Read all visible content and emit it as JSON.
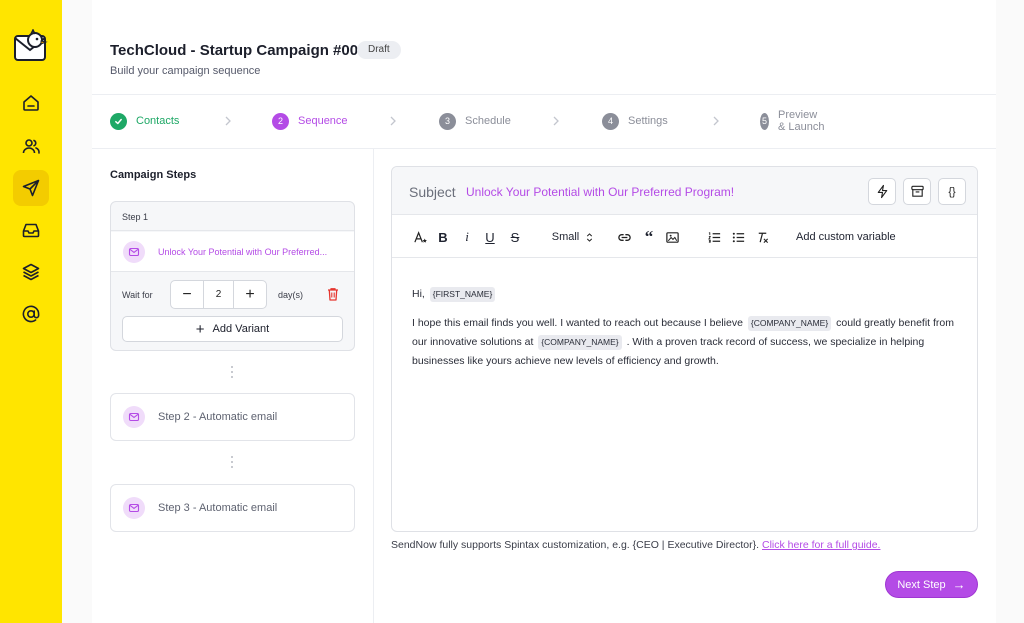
{
  "header": {
    "title": "TechCloud - Startup Campaign #001",
    "badge": "Draft",
    "subtitle": "Build your campaign sequence"
  },
  "stepper": [
    {
      "num": "",
      "label": "Contacts",
      "state": "done"
    },
    {
      "num": "2",
      "label": "Sequence",
      "state": "current"
    },
    {
      "num": "3",
      "label": "Schedule",
      "state": "pending"
    },
    {
      "num": "4",
      "label": "Settings",
      "state": "pending"
    },
    {
      "num": "5",
      "label": "Preview & Launch",
      "state": "pending"
    }
  ],
  "steps_panel": {
    "title": "Campaign Steps",
    "step1": {
      "header": "Step 1",
      "subject": "Unlock Your Potential with Our Preferred...",
      "wait_label": "Wait for",
      "wait_value": "2",
      "wait_unit": "day(s)",
      "add_variant": "Add Variant"
    },
    "step2": "Step 2 - Automatic email",
    "step3": "Step 3 - Automatic email"
  },
  "editor": {
    "subject_label": "Subject",
    "subject_value": "Unlock Your Potential with Our Preferred Program!",
    "code_label": "{}",
    "font_size": "Small",
    "add_custom_variable": "Add custom variable",
    "greeting": "Hi,",
    "first_name_tag": "{FIRST_NAME}",
    "body_1": "I hope this email finds you well. I wanted to reach out because I believe",
    "company_tag_1": "{COMPANY_NAME}",
    "body_2": "could greatly benefit from our innovative solutions at",
    "company_tag_2": "{COMPANY_NAME}",
    "body_3": ". With a proven track record of success, we specialize in helping businesses like yours achieve new levels of efficiency and growth."
  },
  "footer": {
    "spintax_text": "SendNow fully supports Spintax customization, e.g. {CEO | Executive Director}.",
    "spintax_link": "Click here for a full guide.",
    "next_step": "Next Step"
  },
  "colors": {
    "rail": "#ffe500",
    "accent": "#b44be6",
    "success": "#1ea866",
    "pending": "#8b8e99"
  }
}
